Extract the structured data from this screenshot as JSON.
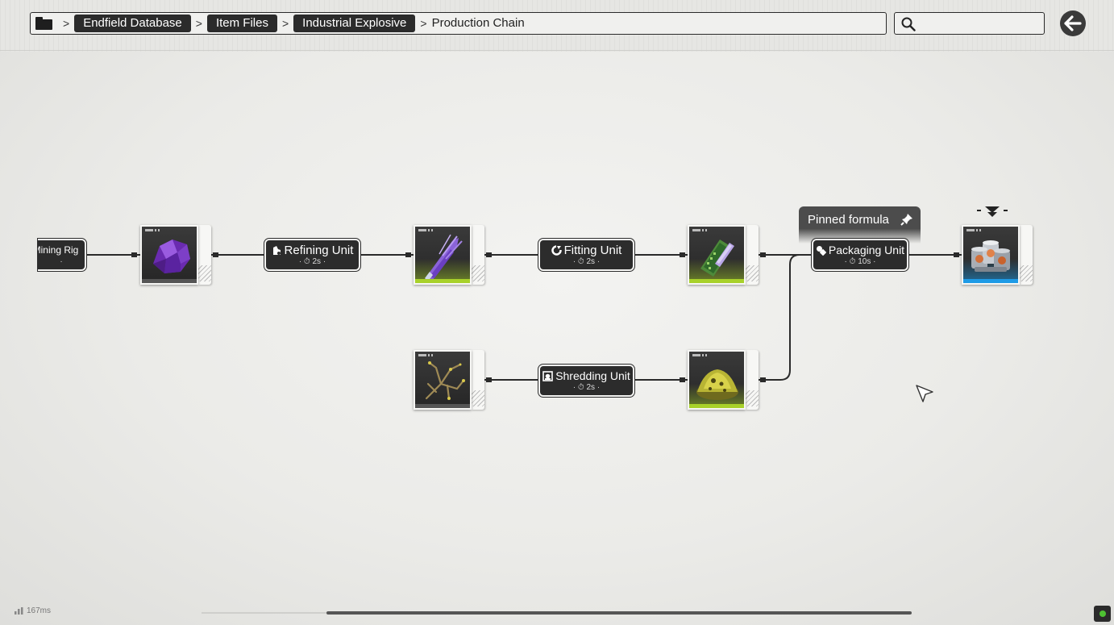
{
  "header": {
    "breadcrumb": [
      "Endfield Database",
      "Item Files",
      "Industrial Explosive"
    ],
    "current": "Production Chain",
    "search_placeholder": ""
  },
  "chain": {
    "machines": {
      "mining": {
        "label": "Mining Rig",
        "time": ""
      },
      "refining": {
        "label": "Refining Unit",
        "time": "2s"
      },
      "fitting": {
        "label": "Fitting Unit",
        "time": "2s"
      },
      "packaging": {
        "label": "Packaging Unit",
        "time": "10s"
      },
      "shredding": {
        "label": "Shredding Unit",
        "time": "2s"
      }
    },
    "items": [
      {
        "id": "amethyst-ore",
        "rarity": "none",
        "icon": "purple-crystal-icon"
      },
      {
        "id": "amethyst-fiber",
        "rarity": "green",
        "icon": "purple-fiber-icon"
      },
      {
        "id": "amethyst-part",
        "rarity": "green",
        "icon": "green-circuit-icon"
      },
      {
        "id": "plant-material",
        "rarity": "none",
        "icon": "dry-branch-icon"
      },
      {
        "id": "plant-powder",
        "rarity": "green",
        "icon": "yellow-powder-icon"
      },
      {
        "id": "industrial-explosive",
        "rarity": "blue",
        "icon": "explosive-canisters-icon"
      }
    ],
    "pinned_label": "Pinned formula"
  },
  "footer": {
    "latency": "167ms"
  },
  "colors": {
    "rarity_green": "#a8d12a",
    "rarity_blue": "#1e9be6",
    "status_ok": "#4ec232"
  }
}
